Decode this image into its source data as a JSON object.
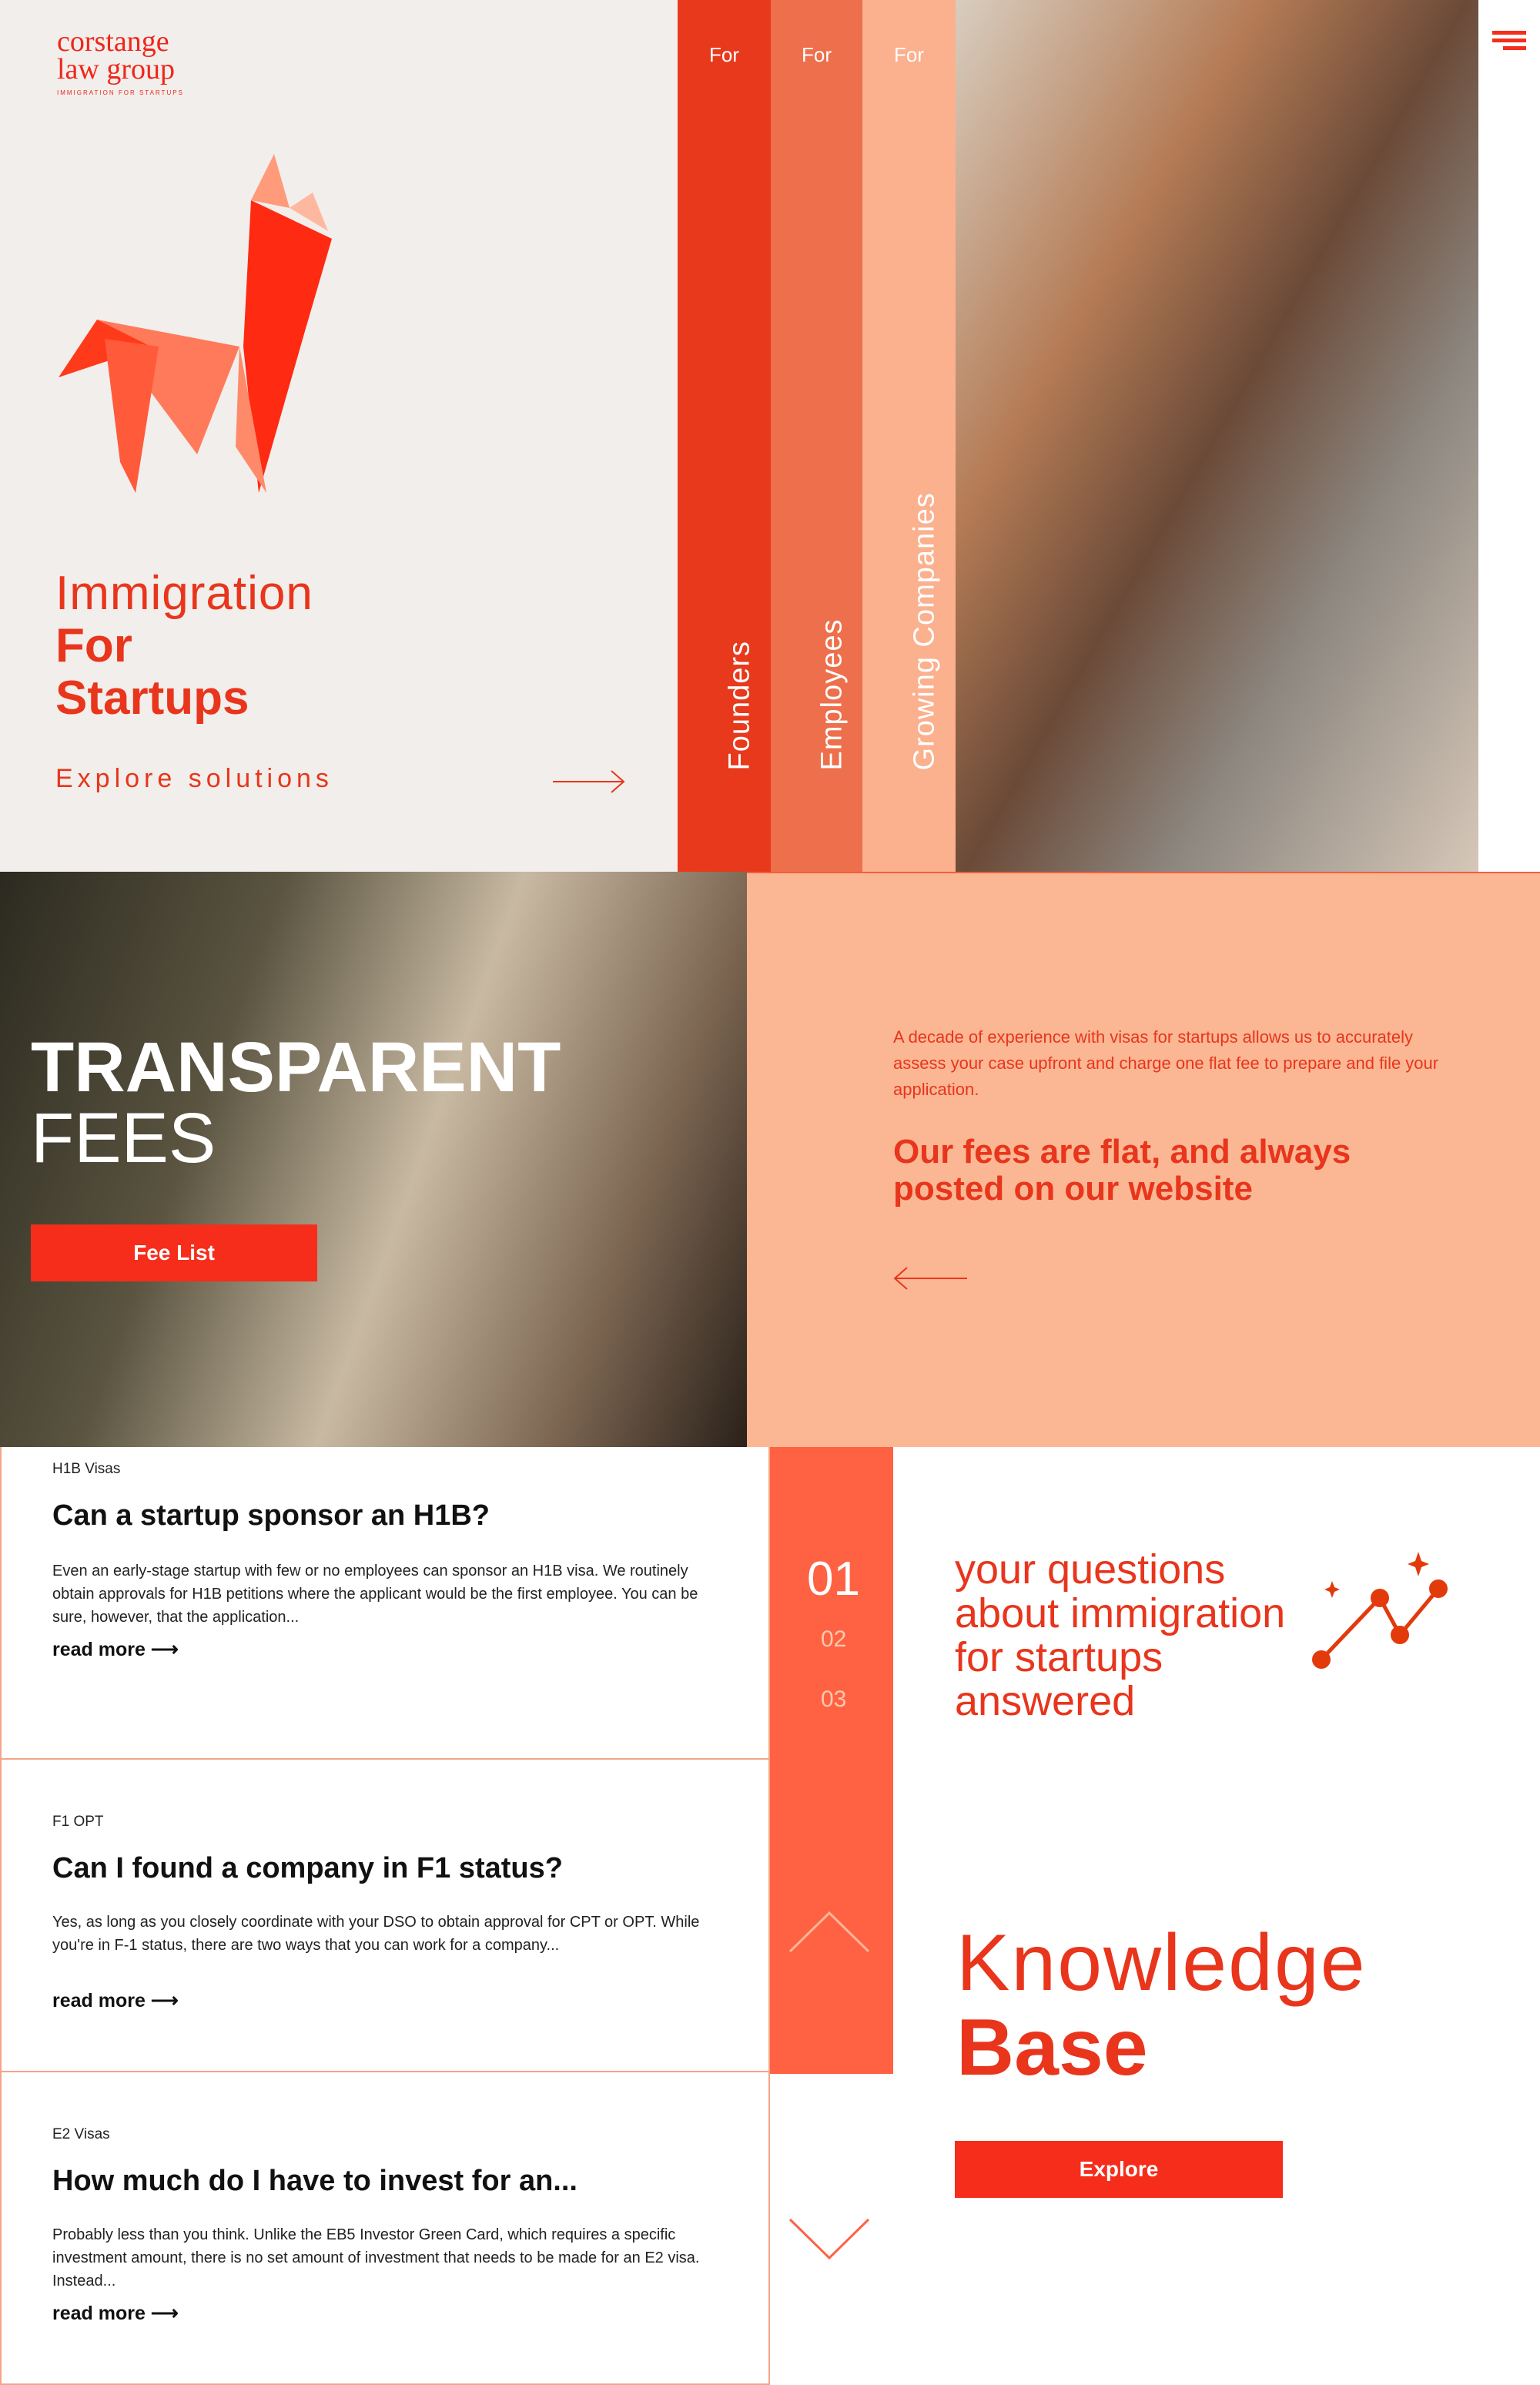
{
  "brand": {
    "line1": "corstange",
    "line2": "law group",
    "tagline": "IMMIGRATION FOR STARTUPS"
  },
  "hero": {
    "title_light": "Immigration",
    "title_bold_1": "For",
    "title_bold_2": "Startups",
    "explore": "Explore solutions"
  },
  "columns": [
    {
      "for": "For",
      "label": "Founders",
      "color": "#e8391c"
    },
    {
      "for": "For",
      "label": "Employees",
      "color": "#ee6f4c"
    },
    {
      "for": "For",
      "label": "Growing Companies",
      "color": "#fbb08e"
    }
  ],
  "fees": {
    "title_1": "TRANSPARENT",
    "title_2": "FEES",
    "button": "Fee List",
    "body": "A decade of experience with visas for startups allows us to accurately assess your case upfront and charge one flat fee to prepare and file your application.",
    "headline": "Our fees are flat, and always posted on our website"
  },
  "articles": [
    {
      "tag": "H1B Visas",
      "title": "Can a startup sponsor an H1B?",
      "excerpt": "Even an early-stage startup with few or no employees can sponsor an H1B visa. We routinely obtain approvals for H1B petitions where the applicant would be the first employee. You can be sure, however, that the application...",
      "link": "read more"
    },
    {
      "tag": "F1 OPT",
      "title": "Can I found a company in F1 status?",
      "excerpt": "Yes, as long as you closely coordinate with your DSO to obtain approval for CPT or OPT. While you're in F-1 status, there are two ways that you can work for a company...",
      "link": "read more"
    },
    {
      "tag": "E2 Visas",
      "title": "How much do I have to invest for an...",
      "excerpt": "Probably less than you think. Unlike the EB5 Investor Green Card, which requires a specific investment amount, there is no set amount of investment that needs to be made for an E2 visa. Instead...",
      "link": "read more"
    }
  ],
  "pager": [
    "01",
    "02",
    "03"
  ],
  "kb": {
    "intro": "your questions about immigration for startups answered",
    "title_1": "Knowledge",
    "title_2": "Base",
    "button": "Explore"
  },
  "colors": {
    "accent": "#f62d1a",
    "peach": "#fbb794",
    "bar": "#ff6242"
  }
}
